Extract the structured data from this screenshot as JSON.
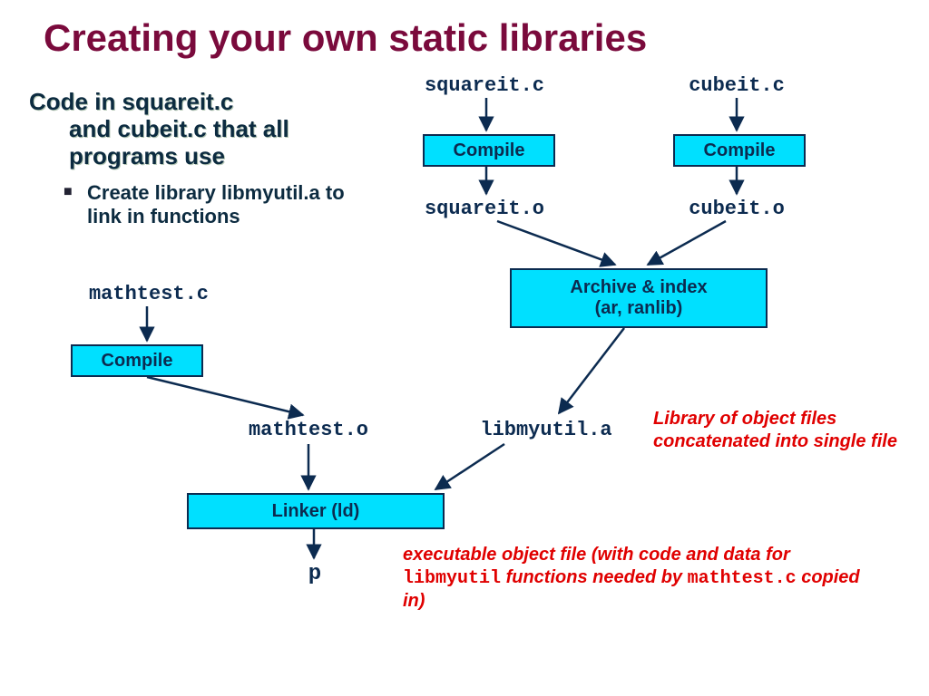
{
  "title": "Creating your own static libraries",
  "subhead_line1": "Code in squareit.c",
  "subhead_line2": "and cubeit.c that all programs use",
  "bullet1": "Create library libmyutil.a to link in functions",
  "files": {
    "squareit_c": "squareit.c",
    "cubeit_c": "cubeit.c",
    "squareit_o": "squareit.o",
    "cubeit_o": "cubeit.o",
    "mathtest_c": "mathtest.c",
    "mathtest_o": "mathtest.o",
    "libmyutil_a": "libmyutil.a",
    "p": "p"
  },
  "boxes": {
    "compile": "Compile",
    "archive": "Archive & index\n(ar, ranlib)",
    "linker": "Linker (ld)"
  },
  "notes": {
    "library_note": "Library of object files concatenated into single file",
    "exec_prefix": "executable object file (with code and data for ",
    "exec_mid": " functions needed by ",
    "exec_suffix": " copied in)",
    "libmyutil_tok": "libmyutil",
    "mathtest_tok": "mathtest.c"
  }
}
